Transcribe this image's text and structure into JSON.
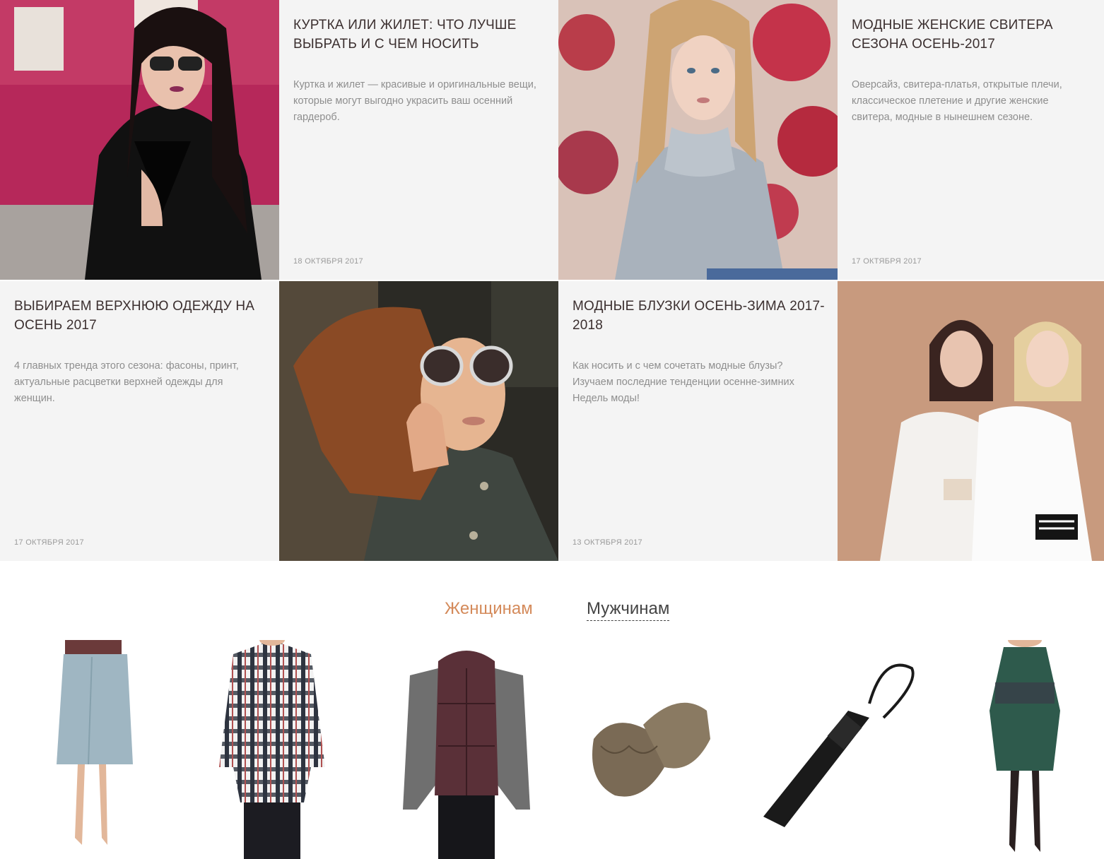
{
  "articles": [
    {
      "title": "Куртка или жилет: что лучше выбрать и с чем носить",
      "excerpt": "Куртка и жилет — красивые и оригинальные вещи, которые могут выгодно украсить ваш осенний гардероб.",
      "date": "18 октября 2017",
      "photo": "woman-leather-jacket-photo"
    },
    {
      "title": "Модные женские свитера сезона осень-2017",
      "excerpt": "Оверсайз, свитера-платья, открытые плечи, классическое плетение и другие женские свитера, модные в нынешнем сезоне.",
      "date": "17 октября 2017",
      "photo": "woman-grey-sweater-photo"
    },
    {
      "title": "Выбираем верхнюю одежду на осень 2017",
      "excerpt": "4 главных тренда этого сезона: фасоны, принт, актуальные расцветки верхней одежды для женщин.",
      "date": "17 октября 2017",
      "photo": "woman-sunglasses-coat-photo"
    },
    {
      "title": "Модные блузки осень-зима 2017-2018",
      "excerpt": "Как носить и с чем сочетать модные блузы? Изучаем последние тенденции осенне-зимних Недель моды!",
      "date": "13 октября 2017",
      "photo": "two-women-blouses-photo"
    }
  ],
  "tabs": {
    "women": "Женщинам",
    "men": "Мужчинам",
    "active": "women"
  },
  "products": [
    {
      "name": "skirt-product",
      "color": "#9fb6c2"
    },
    {
      "name": "plaid-shirt-product",
      "color": "#2e3440"
    },
    {
      "name": "puffer-vest-product",
      "color": "#5a3038"
    },
    {
      "name": "knit-mittens-product",
      "color": "#7a6a55"
    },
    {
      "name": "umbrella-product",
      "color": "#1a1a1a"
    },
    {
      "name": "knit-dress-product",
      "color": "#2e5a4c"
    }
  ],
  "colors": {
    "accent": "#d48a5a",
    "card_bg": "#f4f4f4",
    "title": "#3b2f2f",
    "muted": "#8e8e8e"
  }
}
